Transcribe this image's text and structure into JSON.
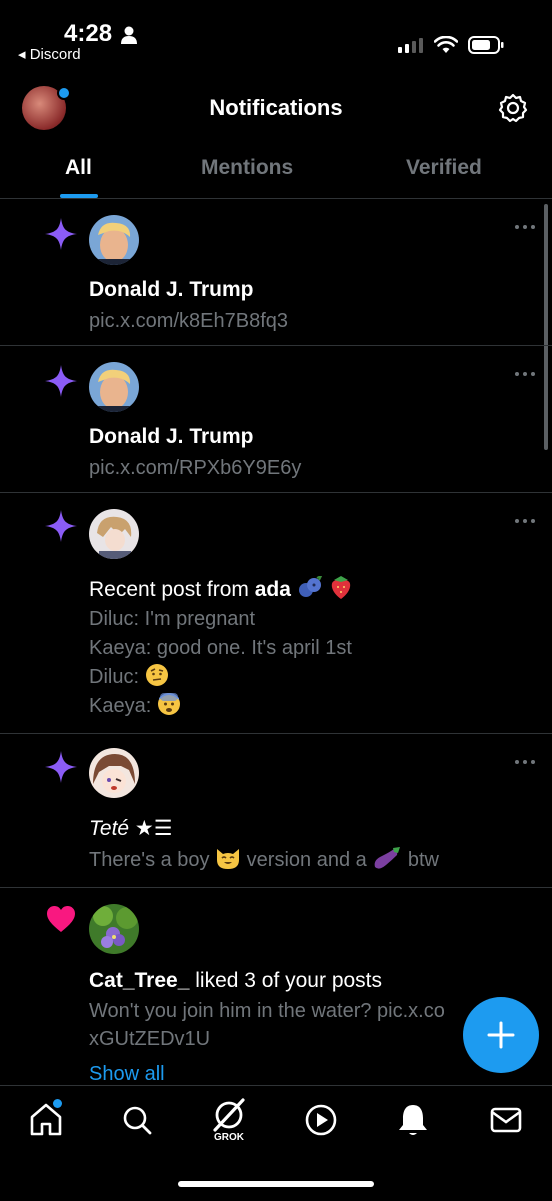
{
  "status_bar": {
    "time": "4:28",
    "back_app": "◂ Discord"
  },
  "header": {
    "title": "Notifications"
  },
  "tabs": [
    {
      "label": "All",
      "active": true
    },
    {
      "label": "Mentions",
      "active": false
    },
    {
      "label": "Verified",
      "active": false
    }
  ],
  "notifications": [
    {
      "kind": "sparkle",
      "name": "Donald J. Trump",
      "link": "pic.x.com/k8Eh7B8fq3"
    },
    {
      "kind": "sparkle",
      "name": "Donald J. Trump",
      "link": "pic.x.com/RPXb6Y9E6y"
    },
    {
      "kind": "sparkle",
      "prefix": "Recent post from ",
      "name": "ada",
      "lines": [
        "Diluc: I'm pregnant",
        "Kaeya: good one. It's april 1st",
        "Diluc:",
        "Kaeya:"
      ]
    },
    {
      "kind": "sparkle",
      "name": "Teté ★☰",
      "text_a": "There's a boy",
      "text_b": "version and a",
      "text_c": "btw"
    },
    {
      "kind": "like",
      "name": "Cat_Tree_",
      "action": " liked 3 of your posts",
      "line1": "Won't you join him in the water? pic.x.co",
      "line2": "xGUtZEDv1U",
      "show_all": "Show all"
    }
  ],
  "bottom_nav": {
    "grok_label": "GROK"
  },
  "icons": {
    "sparkle_color": "#8b5cf6",
    "heart_color": "#f91880",
    "accent": "#1d9bf0"
  }
}
